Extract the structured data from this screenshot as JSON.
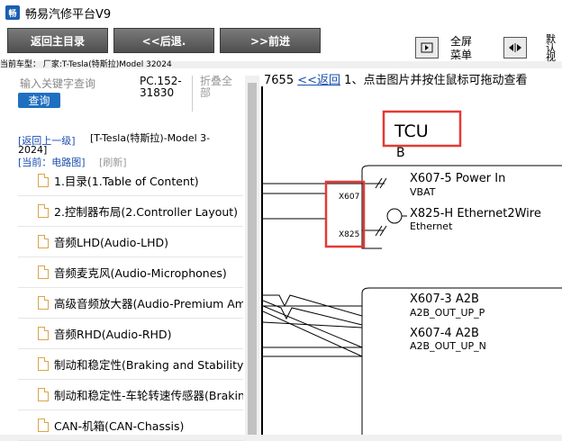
{
  "window": {
    "title": "畅易汽修平台V9",
    "icon_text": "畅"
  },
  "toolbar": {
    "home_label": "返回主目录",
    "back_label": "<<后退.",
    "forward_label": ">>前进",
    "fullscreen_label": "全屏\n菜单",
    "default_label": "默\n认\n视"
  },
  "car_info": "当前车型： 厂家:T-Tesla(特斯拉)Model 32024",
  "search": {
    "placeholder": "输入关键字查询",
    "query_label": "查询",
    "pc_code": "PC.152-31830",
    "fold_all": "折叠全部"
  },
  "nav": {
    "back_level": "[返回上一级]",
    "crumb": "[T-Tesla(特斯拉)-Model 3-",
    "crumb_cont": "2024]",
    "current": "[当前：电路图]",
    "refresh": "[刷新]"
  },
  "items": [
    {
      "label": "1.目录(1.Table of Content)"
    },
    {
      "label": "2.控制器布局(2.Controller Layout)"
    },
    {
      "label": "音频LHD(Audio-LHD)"
    },
    {
      "label": "音频麦克风(Audio-Microphones)"
    },
    {
      "label": "高级音频放大器(Audio-Premium Amplifier)"
    },
    {
      "label": "音频RHD(Audio-RHD)"
    },
    {
      "label": "制动和稳定性(Braking and Stability)"
    },
    {
      "label": "制动和稳定性-车轮转速传感器(Braking and Stability)"
    },
    {
      "label": "CAN-机箱(CAN-Chassis)"
    }
  ],
  "page": {
    "number": "7655",
    "back": "<<返回",
    "hint": "1、点击图片并按住鼠标可拖动查看"
  },
  "diagram": {
    "tcu": "TCU",
    "b": "B",
    "c1": "X607",
    "c2": "X825",
    "p1": "X607-5 Power In",
    "p1s": "VBAT",
    "p2": "X825-H Ethernet2Wire",
    "p2s": "Ethernet",
    "p3": "X607-3 A2B",
    "p3s": "A2B_OUT_UP_P",
    "p4": "X607-4 A2B",
    "p4s": "A2B_OUT_UP_N"
  },
  "colors": {
    "highlight": "#e53935",
    "link": "#1a4fb0",
    "button_bg": "#5a5a5a"
  }
}
